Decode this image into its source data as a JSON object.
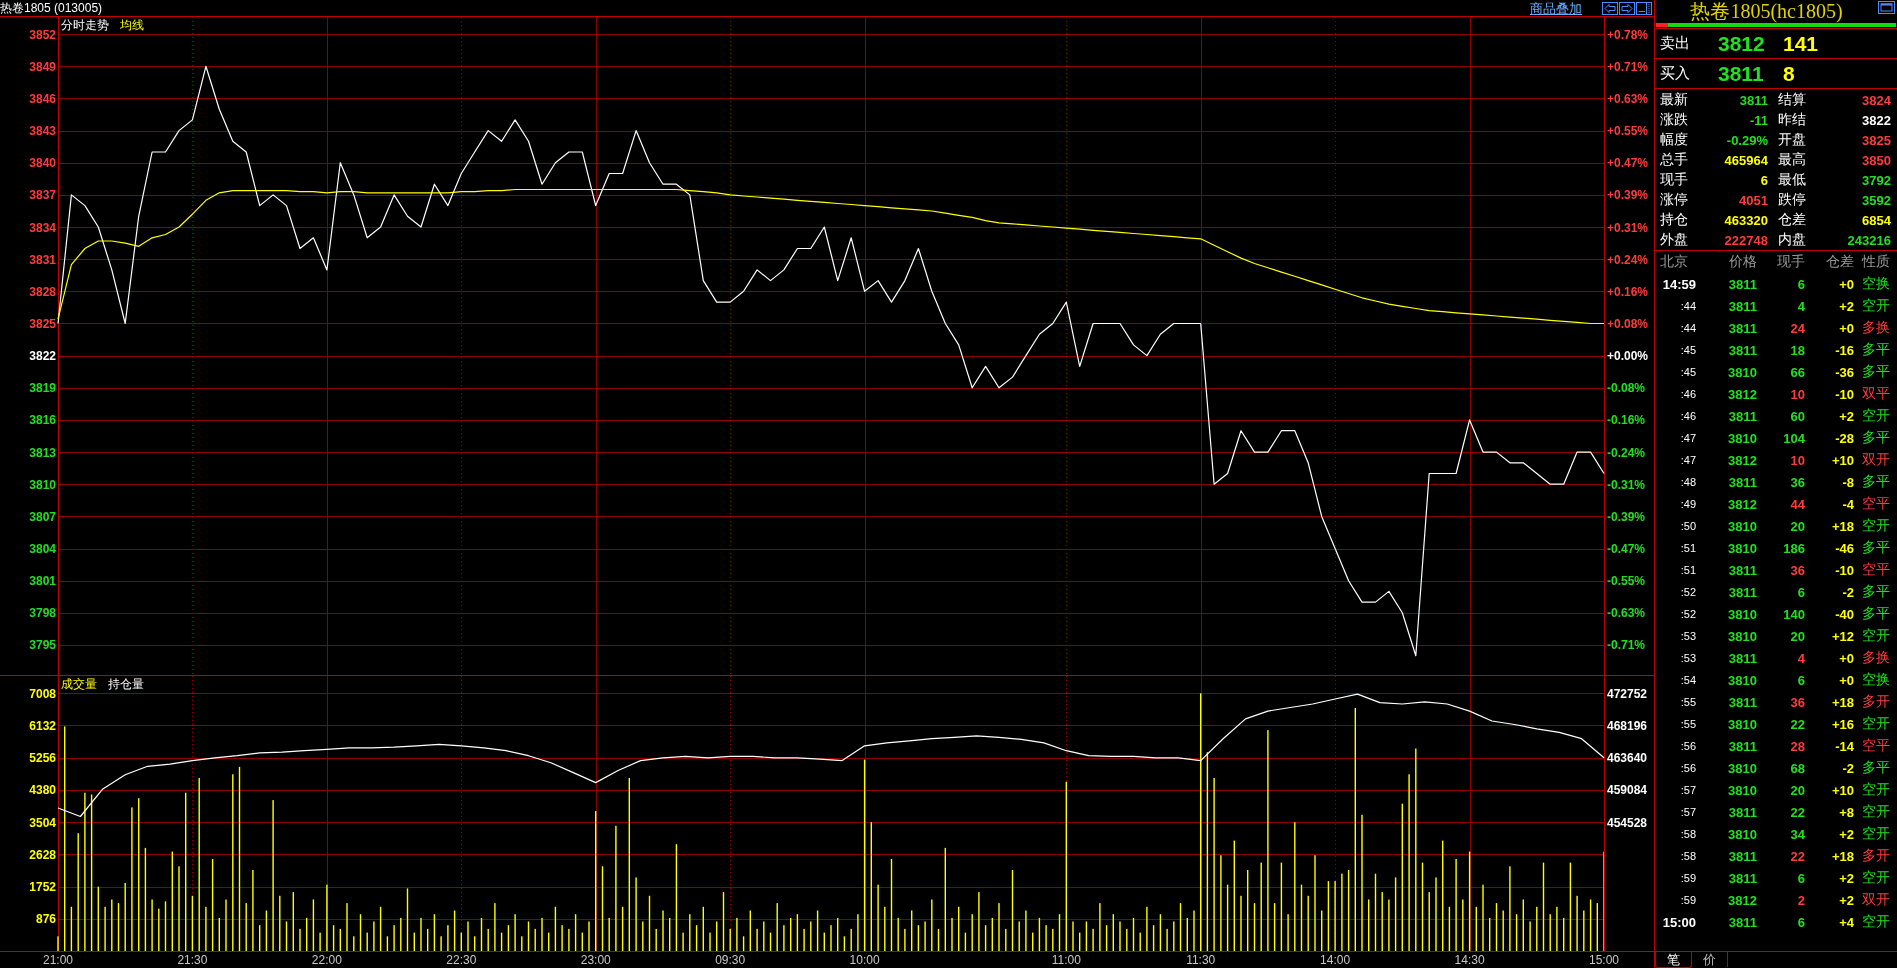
{
  "header": {
    "title": "热卷1805 (013005)",
    "link": "商品叠加"
  },
  "upper_chart": {
    "percent_axis": [
      {
        "label": "+0.78%",
        "color": "#ff3c3c"
      },
      {
        "label": "+0.71%",
        "color": "#ff3c3c"
      },
      {
        "label": "+0.63%",
        "color": "#ff3c3c"
      },
      {
        "label": "+0.55%",
        "color": "#ff3c3c"
      },
      {
        "label": "+0.47%",
        "color": "#ff3c3c"
      },
      {
        "label": "+0.39%",
        "color": "#ff3c3c"
      },
      {
        "label": "+0.31%",
        "color": "#ff3c3c"
      },
      {
        "label": "+0.24%",
        "color": "#ff3c3c"
      },
      {
        "label": "+0.16%",
        "color": "#ff3c3c"
      },
      {
        "label": "+0.08%",
        "color": "#ff3c3c"
      },
      {
        "label": "+0.00%",
        "color": "#ffffff"
      },
      {
        "label": "-0.08%",
        "color": "#20e020"
      },
      {
        "label": "-0.16%",
        "color": "#20e020"
      },
      {
        "label": "-0.24%",
        "color": "#20e020"
      },
      {
        "label": "-0.31%",
        "color": "#20e020"
      },
      {
        "label": "-0.39%",
        "color": "#20e020"
      },
      {
        "label": "-0.47%",
        "color": "#20e020"
      },
      {
        "label": "-0.55%",
        "color": "#20e020"
      },
      {
        "label": "-0.63%",
        "color": "#20e020"
      },
      {
        "label": "-0.71%",
        "color": "#20e020"
      }
    ],
    "chart_data": {
      "type": "line",
      "grid": true,
      "categories": [
        null,
        null,
        null,
        null,
        null,
        null,
        null,
        null,
        null,
        null,
        null,
        null,
        null,
        null,
        null,
        null,
        null,
        null,
        null,
        null,
        null,
        null,
        null,
        null,
        null,
        null,
        null,
        null,
        null,
        null,
        null,
        null,
        null,
        null,
        null,
        null,
        null,
        null,
        null,
        null,
        null,
        null,
        null,
        null,
        null,
        null,
        null,
        null,
        null,
        null,
        null,
        null,
        null,
        null,
        null,
        null,
        null,
        null,
        null,
        null,
        null,
        null,
        null,
        null,
        null,
        null,
        null,
        null,
        null,
        null,
        null,
        null,
        null,
        null,
        null,
        null,
        null,
        null,
        null,
        null,
        null,
        null,
        null,
        null,
        null,
        null,
        null,
        null,
        null,
        null,
        null,
        null,
        null,
        null,
        null,
        null,
        null,
        null,
        null,
        null,
        null,
        null,
        null,
        null,
        null,
        null,
        null,
        null,
        null,
        null,
        null,
        null,
        null,
        null,
        null,
        null
      ],
      "series": [
        {
          "name": "分时走势",
          "color": "#ffffff",
          "values": [
            3825,
            3837,
            3836,
            3834,
            3830,
            3825,
            3835,
            3841,
            3841,
            3843,
            3844,
            3849,
            3845,
            3842,
            3841,
            3836,
            3837,
            3836,
            3832,
            3833,
            3830,
            3840,
            3837,
            3833,
            3834,
            3837,
            3835,
            3834,
            3838,
            3836,
            3839,
            3841,
            3843,
            3842,
            3844,
            3842,
            3838,
            3840,
            3841,
            3841,
            3836,
            3839,
            3839,
            3843,
            3840,
            3838,
            3838,
            3837,
            3829,
            3827,
            3827,
            3828,
            3830,
            3829,
            3830,
            3832,
            3832,
            3834,
            3829,
            3833,
            3828,
            3829,
            3827,
            3829,
            3832,
            3828,
            3825,
            3823,
            3819,
            3821,
            3819,
            3820,
            3822,
            3824,
            3825,
            3827,
            3821,
            3825,
            3825,
            3825,
            3823,
            3822,
            3824,
            3825,
            3825,
            3825,
            3810,
            3811,
            3815,
            3813,
            3813,
            3815,
            3815,
            3812,
            3807,
            3804,
            3801,
            3799,
            3799,
            3800,
            3798,
            3794,
            3811,
            3811,
            3811,
            3816,
            3813,
            3813,
            3812,
            3812,
            3811,
            3810,
            3810,
            3813,
            3813,
            3811
          ]
        },
        {
          "name": "均线",
          "color": "#ffff00",
          "values": [
            3825.4,
            3830.5,
            3832.0,
            3832.7,
            3832.7,
            3832.5,
            3832.2,
            3833.0,
            3833.3,
            3834.0,
            3835.2,
            3836.5,
            3837.2,
            3837.4,
            3837.4,
            3837.4,
            3837.4,
            3837.4,
            3837.3,
            3837.3,
            3837.2,
            3837.3,
            3837.3,
            3837.2,
            3837.2,
            3837.2,
            3837.2,
            3837.2,
            3837.2,
            3837.2,
            3837.3,
            3837.3,
            3837.4,
            3837.4,
            3837.5,
            3837.5,
            3837.5,
            3837.5,
            3837.5,
            3837.5,
            3837.5,
            3837.5,
            3837.5,
            3837.5,
            3837.5,
            3837.5,
            3837.5,
            3837.4,
            3837.3,
            3837.2,
            3837.0,
            3836.9,
            3836.8,
            3836.7,
            3836.6,
            3836.5,
            3836.4,
            3836.3,
            3836.2,
            3836.1,
            3836.0,
            3835.9,
            3835.8,
            3835.7,
            3835.6,
            3835.5,
            3835.3,
            3835.1,
            3834.9,
            3834.6,
            3834.4,
            3834.3,
            3834.2,
            3834.1,
            3834.0,
            3833.9,
            3833.8,
            3833.7,
            3833.6,
            3833.5,
            3833.4,
            3833.3,
            3833.2,
            3833.1,
            3833.0,
            3832.9,
            3832.3,
            3831.7,
            3831.1,
            3830.6,
            3830.2,
            3829.8,
            3829.4,
            3829.0,
            3828.6,
            3828.2,
            3827.8,
            3827.4,
            3827.1,
            3826.8,
            3826.6,
            3826.4,
            3826.2,
            3826.1,
            3826.0,
            3825.9,
            3825.8,
            3825.7,
            3825.6,
            3825.5,
            3825.4,
            3825.3,
            3825.2,
            3825.1,
            3825.0,
            3825.0
          ]
        }
      ],
      "ylim": [
        3792.2,
        3853.6
      ],
      "yticks": [
        3852,
        3849,
        3846,
        3843,
        3840,
        3837,
        3834,
        3831,
        3828,
        3825,
        3822,
        3819,
        3816,
        3813,
        3810,
        3807,
        3804,
        3801,
        3798,
        3795
      ]
    }
  },
  "lower_chart": {
    "volume": {
      "chart_data": {
        "type": "bar",
        "grid": true,
        "categories": [
          "21:00",
          null,
          null,
          null,
          null,
          null,
          null,
          null,
          null,
          null,
          null,
          null,
          null,
          null,
          null,
          null,
          null,
          null,
          null,
          null,
          "21:30",
          null,
          null,
          null,
          null,
          null,
          null,
          null,
          null,
          null,
          null,
          null,
          null,
          null,
          null,
          null,
          null,
          null,
          null,
          null,
          "22:00",
          null,
          null,
          null,
          null,
          null,
          null,
          null,
          null,
          null,
          null,
          null,
          null,
          null,
          null,
          null,
          null,
          null,
          null,
          null,
          "22:30",
          null,
          null,
          null,
          null,
          null,
          null,
          null,
          null,
          null,
          null,
          null,
          null,
          null,
          null,
          null,
          null,
          null,
          null,
          null,
          "23:00",
          null,
          null,
          null,
          null,
          null,
          null,
          null,
          null,
          null,
          null,
          null,
          null,
          null,
          null,
          null,
          null,
          null,
          null,
          null,
          "09:30",
          null,
          null,
          null,
          null,
          null,
          null,
          null,
          null,
          null,
          null,
          null,
          null,
          null,
          null,
          null,
          null,
          null,
          null,
          null,
          "10:00",
          null,
          null,
          null,
          null,
          null,
          null,
          null,
          null,
          null,
          null,
          null,
          null,
          null,
          null,
          null,
          null,
          null,
          null,
          null,
          null,
          null,
          null,
          null,
          null,
          null,
          null,
          null,
          null,
          null,
          "11:00",
          null,
          null,
          null,
          null,
          null,
          null,
          null,
          null,
          null,
          null,
          null,
          null,
          null,
          null,
          null,
          null,
          null,
          null,
          null,
          "11:30",
          null,
          null,
          null,
          null,
          null,
          null,
          null,
          null,
          null,
          null,
          null,
          null,
          null,
          null,
          null,
          null,
          null,
          null,
          null,
          "14:00",
          null,
          null,
          null,
          null,
          null,
          null,
          null,
          null,
          null,
          null,
          null,
          null,
          null,
          null,
          null,
          null,
          null,
          null,
          null,
          "14:30",
          null,
          null,
          null,
          null,
          null,
          null,
          null,
          null,
          null,
          null,
          null,
          null,
          null,
          null,
          null,
          null,
          null,
          null,
          null,
          "15:00"
        ],
        "series": [
          {
            "name": "成交量",
            "color": "#ffff00",
            "values": [
              400,
              6100,
              1200,
              3200,
              4300,
              4250,
              1750,
              1200,
              1400,
              1300,
              1850,
              3900,
              4150,
              2800,
              1400,
              1150,
              1350,
              2700,
              2300,
              4300,
              1500,
              4700,
              1200,
              2500,
              900,
              1400,
              4800,
              5000,
              1300,
              2200,
              700,
              1100,
              4100,
              1500,
              800,
              1600,
              600,
              900,
              1400,
              500,
              1800,
              700,
              600,
              1300,
              400,
              1000,
              500,
              800,
              1200,
              400,
              700,
              900,
              1700,
              500,
              900,
              600,
              1000,
              400,
              700,
              1100,
              500,
              800,
              400,
              900,
              600,
              1300,
              500,
              700,
              1000,
              400,
              800,
              600,
              900,
              500,
              1200,
              700,
              600,
              1000,
              500,
              800,
              3800,
              2300,
              900,
              3400,
              1200,
              4700,
              2000,
              800,
              1500,
              600,
              1100,
              900,
              2900,
              500,
              1000,
              700,
              1200,
              500,
              800,
              1600,
              600,
              900,
              400,
              1100,
              600,
              800,
              500,
              1300,
              700,
              900,
              1000,
              600,
              800,
              1100,
              500,
              700,
              900,
              400,
              600,
              1000,
              5200,
              3500,
              1800,
              1200,
              2500,
              900,
              600,
              1100,
              700,
              800,
              1400,
              600,
              2800,
              900,
              1200,
              500,
              1000,
              1600,
              700,
              900,
              1300,
              600,
              2200,
              800,
              1100,
              500,
              900,
              700,
              600,
              1000,
              4600,
              800,
              500,
              800,
              600,
              1300,
              700,
              1000,
              800,
              600,
              900,
              500,
              1200,
              700,
              1000,
              600,
              800,
              1300,
              900,
              1100,
              7000,
              5400,
              4700,
              2600,
              1800,
              3000,
              1500,
              2200,
              1300,
              2400,
              6000,
              1300,
              2400,
              1000,
              3500,
              1800,
              1500,
              2600,
              1100,
              1900,
              1900,
              2100,
              2200,
              6600,
              3700,
              1400,
              2100,
              1600,
              1400,
              2000,
              4000,
              4800,
              5500,
              2400,
              1600,
              2000,
              3000,
              1200,
              2500,
              1400,
              2700,
              1200,
              1800,
              900,
              1300,
              1100,
              2300,
              1000,
              1400,
              800,
              1200,
              2400,
              1000,
              1200,
              900,
              2400,
              1500,
              1100,
              1400,
              1300,
              2700
            ]
          }
        ],
        "ylim": [
          0,
          7470
        ],
        "yticks": [
          7008,
          6132,
          5256,
          4380,
          3504,
          2628,
          1752,
          876
        ]
      }
    },
    "open_interest": {
      "chart_data": {
        "type": "line",
        "categories": [
          null,
          null,
          null,
          null,
          null,
          null,
          null,
          null,
          null,
          null,
          null,
          null,
          null,
          null,
          null,
          null,
          null,
          null,
          null,
          null,
          null,
          null,
          null,
          null,
          null,
          null,
          null,
          null,
          null,
          null,
          null,
          null,
          null,
          null,
          null,
          null,
          null,
          null,
          null,
          null,
          null,
          null,
          null,
          null,
          null,
          null,
          null,
          null,
          null,
          null,
          null,
          null,
          null,
          null,
          null,
          null,
          null,
          null,
          null,
          null,
          null,
          null,
          null,
          null,
          null,
          null,
          null,
          null,
          null,
          null
        ],
        "series": [
          {
            "name": "持仓量",
            "color": "#ffffff",
            "values": [
              456500,
              455300,
              459200,
              461200,
              462400,
              462700,
              463200,
              463600,
              463900,
              464300,
              464400,
              464600,
              464800,
              465000,
              465000,
              465100,
              465300,
              465500,
              465300,
              465000,
              464600,
              463900,
              462900,
              461500,
              460100,
              461800,
              463200,
              463600,
              463800,
              463600,
              463800,
              463800,
              463600,
              463600,
              463400,
              463200,
              465300,
              465700,
              466000,
              466300,
              466500,
              466700,
              466500,
              466200,
              465700,
              464600,
              463900,
              463800,
              463800,
              463600,
              463600,
              463200,
              466300,
              469100,
              470200,
              470700,
              471200,
              471900,
              472600,
              471400,
              471200,
              471500,
              471200,
              470200,
              468800,
              468300,
              467700,
              467200,
              466300,
              463600
            ]
          }
        ],
        "ylim": [
          436304,
          475154
        ],
        "yticks": [
          472752,
          468196,
          463640,
          459084,
          454528
        ]
      }
    }
  },
  "quote_panel": {
    "title": "热卷1805(hc1805)",
    "ratio_bar": {
      "level": 0.05
    },
    "orders": [
      {
        "label": "卖出",
        "price": "3812",
        "volume": "141"
      },
      {
        "label": "买入",
        "price": "3811",
        "volume": "8"
      }
    ],
    "stats": [
      {
        "label": "最新",
        "value": "3811",
        "color": "#20e020"
      },
      {
        "label": "结算",
        "value": "3824",
        "color": "#ff3c3c"
      },
      {
        "label": "涨跌",
        "value": "-11",
        "color": "#20e020"
      },
      {
        "label": "昨结",
        "value": "3822",
        "color": "#ffffff"
      },
      {
        "label": "幅度",
        "value": "-0.29%",
        "color": "#20e020"
      },
      {
        "label": "开盘",
        "value": "3825",
        "color": "#ff3c3c"
      },
      {
        "label": "总手",
        "value": "465964",
        "color": "#ffff00"
      },
      {
        "label": "最高",
        "value": "3850",
        "color": "#ff3c3c"
      },
      {
        "label": "现手",
        "value": "6",
        "color": "#ffff00"
      },
      {
        "label": "最低",
        "value": "3792",
        "color": "#20e020"
      },
      {
        "label": "涨停",
        "value": "4051",
        "color": "#ff3c3c"
      },
      {
        "label": "跌停",
        "value": "3592",
        "color": "#20e020"
      },
      {
        "label": "持仓",
        "value": "463320",
        "color": "#ffff00"
      },
      {
        "label": "仓差",
        "value": "6854",
        "color": "#ffff00"
      },
      {
        "label": "外盘",
        "value": "222748",
        "color": "#ff3c3c"
      },
      {
        "label": "内盘",
        "value": "243216",
        "color": "#20e020"
      }
    ],
    "ticks": {
      "columns": [
        "北京",
        "价格",
        "现手",
        "仓差",
        "性质"
      ],
      "rows": [
        {
          "kind": "minute",
          "time": "14:59",
          "price": "3811",
          "volume": "6",
          "oi_change": "+0",
          "nature": "空换",
          "color": "#20e020"
        },
        {
          "kind": "second",
          "time": ":44",
          "price": "3811",
          "volume": "4",
          "oi_change": "+2",
          "nature": "空开",
          "color": "#20e020"
        },
        {
          "kind": "second",
          "time": ":44",
          "price": "3811",
          "volume": "24",
          "oi_change": "+0",
          "nature": "多换",
          "color": "#ff3c3c"
        },
        {
          "kind": "second",
          "time": ":45",
          "price": "3811",
          "volume": "18",
          "oi_change": "-16",
          "nature": "多平",
          "color": "#20e020"
        },
        {
          "kind": "second",
          "time": ":45",
          "price": "3810",
          "volume": "66",
          "oi_change": "-36",
          "nature": "多平",
          "color": "#20e020"
        },
        {
          "kind": "second",
          "time": ":46",
          "price": "3812",
          "volume": "10",
          "oi_change": "-10",
          "nature": "双平",
          "color": "#ff3c3c"
        },
        {
          "kind": "second",
          "time": ":46",
          "price": "3811",
          "volume": "60",
          "oi_change": "+2",
          "nature": "空开",
          "color": "#20e020"
        },
        {
          "kind": "second",
          "time": ":47",
          "price": "3810",
          "volume": "104",
          "oi_change": "-28",
          "nature": "多平",
          "color": "#20e020"
        },
        {
          "kind": "second",
          "time": ":47",
          "price": "3812",
          "volume": "10",
          "oi_change": "+10",
          "nature": "双开",
          "color": "#ff3c3c"
        },
        {
          "kind": "second",
          "time": ":48",
          "price": "3811",
          "volume": "36",
          "oi_change": "-8",
          "nature": "多平",
          "color": "#20e020"
        },
        {
          "kind": "second",
          "time": ":49",
          "price": "3812",
          "volume": "44",
          "oi_change": "-4",
          "nature": "空平",
          "color": "#ff3c3c"
        },
        {
          "kind": "second",
          "time": ":50",
          "price": "3810",
          "volume": "20",
          "oi_change": "+18",
          "nature": "空开",
          "color": "#20e020"
        },
        {
          "kind": "second",
          "time": ":51",
          "price": "3810",
          "volume": "186",
          "oi_change": "-46",
          "nature": "多平",
          "color": "#20e020"
        },
        {
          "kind": "second",
          "time": ":51",
          "price": "3811",
          "volume": "36",
          "oi_change": "-10",
          "nature": "空平",
          "color": "#ff3c3c"
        },
        {
          "kind": "second",
          "time": ":52",
          "price": "3811",
          "volume": "6",
          "oi_change": "-2",
          "nature": "多平",
          "color": "#20e020"
        },
        {
          "kind": "second",
          "time": ":52",
          "price": "3810",
          "volume": "140",
          "oi_change": "-40",
          "nature": "多平",
          "color": "#20e020"
        },
        {
          "kind": "second",
          "time": ":53",
          "price": "3810",
          "volume": "20",
          "oi_change": "+12",
          "nature": "空开",
          "color": "#20e020"
        },
        {
          "kind": "second",
          "time": ":53",
          "price": "3811",
          "volume": "4",
          "oi_change": "+0",
          "nature": "多换",
          "color": "#ff3c3c"
        },
        {
          "kind": "second",
          "time": ":54",
          "price": "3810",
          "volume": "6",
          "oi_change": "+0",
          "nature": "空换",
          "color": "#20e020"
        },
        {
          "kind": "second",
          "time": ":55",
          "price": "3811",
          "volume": "36",
          "oi_change": "+18",
          "nature": "多开",
          "color": "#ff3c3c"
        },
        {
          "kind": "second",
          "time": ":55",
          "price": "3810",
          "volume": "22",
          "oi_change": "+16",
          "nature": "空开",
          "color": "#20e020"
        },
        {
          "kind": "second",
          "time": ":56",
          "price": "3811",
          "volume": "28",
          "oi_change": "-14",
          "nature": "空平",
          "color": "#ff3c3c"
        },
        {
          "kind": "second",
          "time": ":56",
          "price": "3810",
          "volume": "68",
          "oi_change": "-2",
          "nature": "多平",
          "color": "#20e020"
        },
        {
          "kind": "second",
          "time": ":57",
          "price": "3810",
          "volume": "20",
          "oi_change": "+10",
          "nature": "空开",
          "color": "#20e020"
        },
        {
          "kind": "second",
          "time": ":57",
          "price": "3811",
          "volume": "22",
          "oi_change": "+8",
          "nature": "空开",
          "color": "#20e020"
        },
        {
          "kind": "second",
          "time": ":58",
          "price": "3810",
          "volume": "34",
          "oi_change": "+2",
          "nature": "空开",
          "color": "#20e020"
        },
        {
          "kind": "second",
          "time": ":58",
          "price": "3811",
          "volume": "22",
          "oi_change": "+18",
          "nature": "多开",
          "color": "#ff3c3c"
        },
        {
          "kind": "second",
          "time": ":59",
          "price": "3811",
          "volume": "6",
          "oi_change": "+2",
          "nature": "空开",
          "color": "#20e020"
        },
        {
          "kind": "second",
          "time": ":59",
          "price": "3812",
          "volume": "2",
          "oi_change": "+2",
          "nature": "双开",
          "color": "#ff3c3c"
        },
        {
          "kind": "minute",
          "time": "15:00",
          "price": "3811",
          "volume": "6",
          "oi_change": "+4",
          "nature": "空开",
          "color": "#20e020"
        }
      ]
    },
    "tabs": [
      {
        "label": "笔",
        "selected": true
      },
      {
        "label": "价",
        "selected": false
      }
    ]
  }
}
